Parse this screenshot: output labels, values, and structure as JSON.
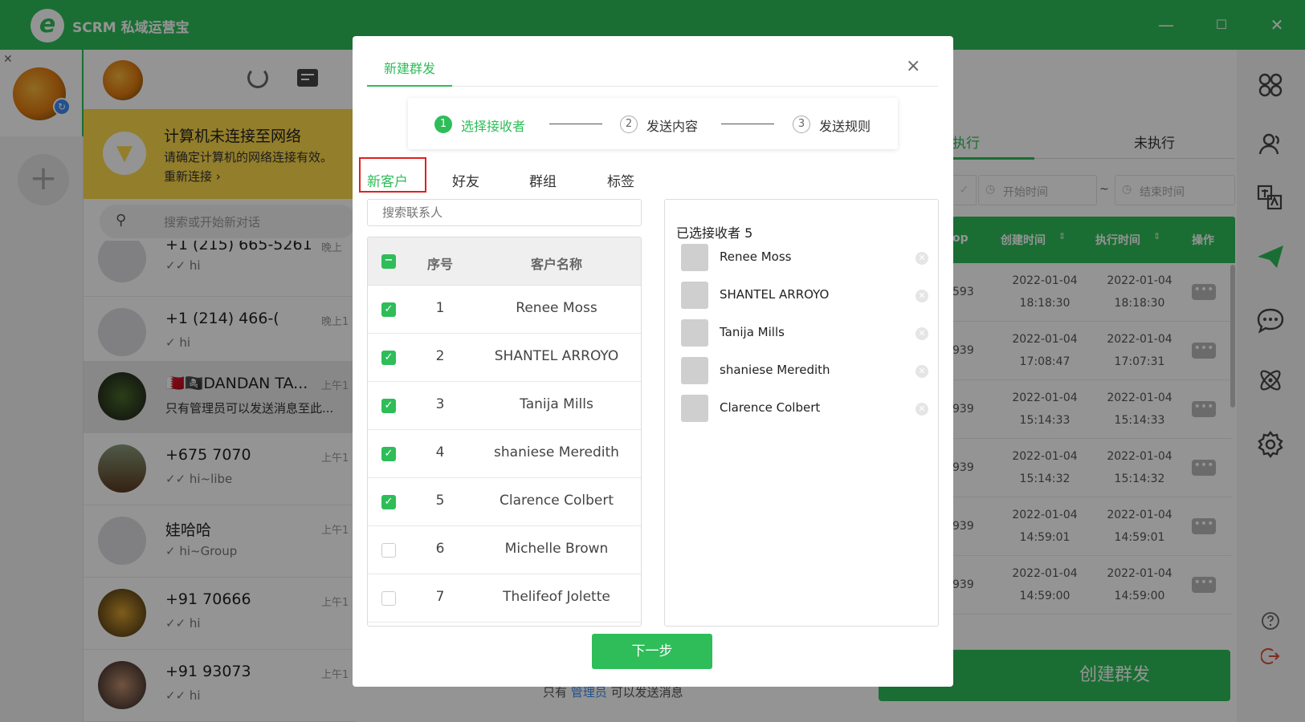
{
  "app": {
    "title": "SCRM 私域运营宝",
    "logo_letter": "e",
    "minimize": "—",
    "maximize": "☐",
    "close": "✕",
    "account_close": "✕",
    "add": "+"
  },
  "offline": {
    "title": "计算机未连接至网络",
    "desc": "请确定计算机的网络连接有效。",
    "reconnect": "重新连接 ›"
  },
  "search": {
    "placeholder": "搜索或开始新对话"
  },
  "chats": [
    {
      "name": "+1 (215) 665-5261",
      "preview": "✓✓ hi",
      "time": "晚上"
    },
    {
      "name": "+1 (214) 466-(",
      "preview": "✓ hi",
      "time": "晚上1"
    },
    {
      "name": "🇧🇭🏴‍☠️DANDAN TA...",
      "preview": "只有管理员可以发送消息至此...",
      "time": "上午1"
    },
    {
      "name": "+675 7070",
      "preview": "✓✓ hi~libe",
      "time": "上午1"
    },
    {
      "name": "娃哈哈",
      "preview": "✓ hi~Group",
      "time": "上午1"
    },
    {
      "name": "+91 70666",
      "preview": "✓✓ hi",
      "time": "上午1"
    },
    {
      "name": "+91 93073",
      "preview": "✓✓ hi",
      "time": "上午1"
    }
  ],
  "right_panel": {
    "tab_executed": "执行",
    "tab_pending": "未执行",
    "start_placeholder": "开始时间",
    "tilde": "~",
    "end_placeholder": "结束时间",
    "headers": [
      "op",
      "创建时间",
      "执行时间",
      "操作"
    ],
    "rows": [
      {
        "id": "593",
        "created": "2022-01-04",
        "created_t": "18:18:30",
        "exec": "2022-01-04",
        "exec_t": "18:18:30"
      },
      {
        "id": "939",
        "created": "2022-01-04",
        "created_t": "17:08:47",
        "exec": "2022-01-04",
        "exec_t": "17:07:31"
      },
      {
        "id": "939",
        "created": "2022-01-04",
        "created_t": "15:14:33",
        "exec": "2022-01-04",
        "exec_t": "15:14:33"
      },
      {
        "id": "939",
        "created": "2022-01-04",
        "created_t": "15:14:32",
        "exec": "2022-01-04",
        "exec_t": "15:14:32"
      },
      {
        "id": "939",
        "created": "2022-01-04",
        "created_t": "14:59:01",
        "exec": "2022-01-04",
        "exec_t": "14:59:01"
      },
      {
        "id": "939",
        "created": "2022-01-04",
        "created_t": "14:59:00",
        "exec": "2022-01-04",
        "exec_t": "14:59:00"
      }
    ],
    "more": "•••",
    "create_button": "创建群发",
    "admin_note_1": "只有",
    "admin_note_2": "管理员",
    "admin_note_3": "可以发送消息"
  },
  "modal": {
    "tab_title": "新建群发",
    "close": "×",
    "steps": [
      {
        "num": "1",
        "label": "选择接收者"
      },
      {
        "num": "2",
        "label": "发送内容"
      },
      {
        "num": "3",
        "label": "发送规则"
      }
    ],
    "category_tabs": [
      "新客户",
      "好友",
      "群组",
      "标签"
    ],
    "search_placeholder": "搜索联系人",
    "table_header": {
      "no": "序号",
      "name": "客户名称",
      "check": "−"
    },
    "customers": [
      {
        "no": "1",
        "name": "Renee Moss",
        "checked": true
      },
      {
        "no": "2",
        "name": "SHANTEL ARROYO",
        "checked": true
      },
      {
        "no": "3",
        "name": "Tanija Mills",
        "checked": true
      },
      {
        "no": "4",
        "name": "shaniese Meredith",
        "checked": true
      },
      {
        "no": "5",
        "name": "Clarence Colbert",
        "checked": true
      },
      {
        "no": "6",
        "name": "Michelle Brown",
        "checked": false
      },
      {
        "no": "7",
        "name": "Thelifeof Jolette",
        "checked": false
      }
    ],
    "selected_title": "已选接收者 5",
    "selected": [
      "Renee Moss",
      "SHANTEL ARROYO",
      "Tanija Mills",
      "shaniese Meredith",
      "Clarence Colbert"
    ],
    "next_button": "下一步"
  },
  "colors": {
    "brand": "#2ebd59",
    "warning": "#fdd94a",
    "highlight": "#e02020"
  }
}
